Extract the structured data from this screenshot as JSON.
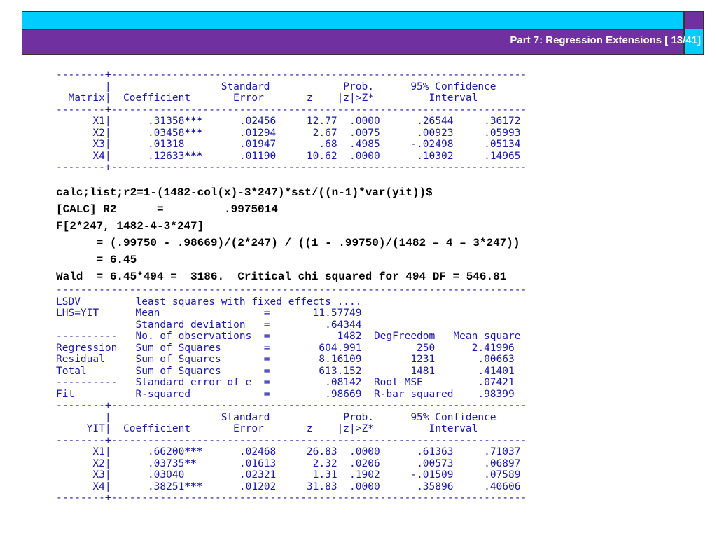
{
  "header": {
    "title": "Part 7: Regression Extensions [ 13/41]"
  },
  "table1": {
    "rule_top": "--------+--------------------------------------------------------------------",
    "head1": "        |                  Standard            Prob.      95% Confidence",
    "head2": "  Matrix|  Coefficient       Error       z    |z|>Z*         Interval",
    "rule_mid": "--------+--------------------------------------------------------------------",
    "rows": [
      {
        "a": "      X1|      .31358",
        "s": "***",
        "b": "      .02456     12.77  .0000      .26544     .36172"
      },
      {
        "a": "      X2|      .03458",
        "s": "***",
        "b": "      .01294      2.67  .0075      .00923     .05993"
      },
      {
        "a": "      X3|      .01318",
        "s": "",
        "b": "         .01947       .68  .4985     -.02498     .05134"
      },
      {
        "a": "      X4|      .12633",
        "s": "***",
        "b": "      .01190     10.62  .0000      .10302     .14965"
      }
    ],
    "rule_bot": "--------+--------------------------------------------------------------------"
  },
  "calc": {
    "line1": "calc;list;r2=1-(1482-col(x)-3*247)*sst/((n-1)*var(yit))$",
    "line2": "[CALC] R2      =         .9975014",
    "line3": "F[2*247, 1482-4-3*247]",
    "line4": "      = (.99750 - .98669)/(2*247) / ((1 - .99750)/(1482 – 4 – 3*247))",
    "line5": "      = 6.45",
    "line6": "Wald  = 6.45*494 =  3186.  Critical chi squared for 494 DF = 546.81"
  },
  "lsdv": {
    "rule0": "-----------------------------------------------------------------------------",
    "lines": [
      "LSDV         least squares with fixed effects ....",
      "LHS=YIT      Mean                 =       11.57749",
      "             Standard deviation   =         .64344",
      "----------   No. of observations  =           1482  DegFreedom   Mean square",
      "Regression   Sum of Squares       =        604.991         250      2.41996",
      "Residual     Sum of Squares       =        8.16109        1231       .00663",
      "Total        Sum of Squares       =        613.152        1481       .41401",
      "----------   Standard error of e  =         .08142  Root MSE         .07421",
      "Fit          R-squared            =         .98669  R-bar squared    .98399"
    ],
    "rule_top": "--------+--------------------------------------------------------------------",
    "head1": "        |                  Standard            Prob.      95% Confidence",
    "head2": "     YIT|  Coefficient       Error       z    |z|>Z*         Interval",
    "rule_mid": "--------+--------------------------------------------------------------------",
    "rows": [
      {
        "a": "      X1|      .66200",
        "s": "***",
        "b": "      .02468     26.83  .0000      .61363     .71037"
      },
      {
        "a": "      X2|      .03735",
        "s": "**",
        "b": "       .01613      2.32  .0206      .00573     .06897"
      },
      {
        "a": "      X3|      .03040",
        "s": "",
        "b": "         .02321      1.31  .1902     -.01509     .07589"
      },
      {
        "a": "      X4|      .38251",
        "s": "***",
        "b": "      .01202     31.83  .0000      .35896     .40606"
      }
    ],
    "rule_bot": "--------+--------------------------------------------------------------------"
  }
}
